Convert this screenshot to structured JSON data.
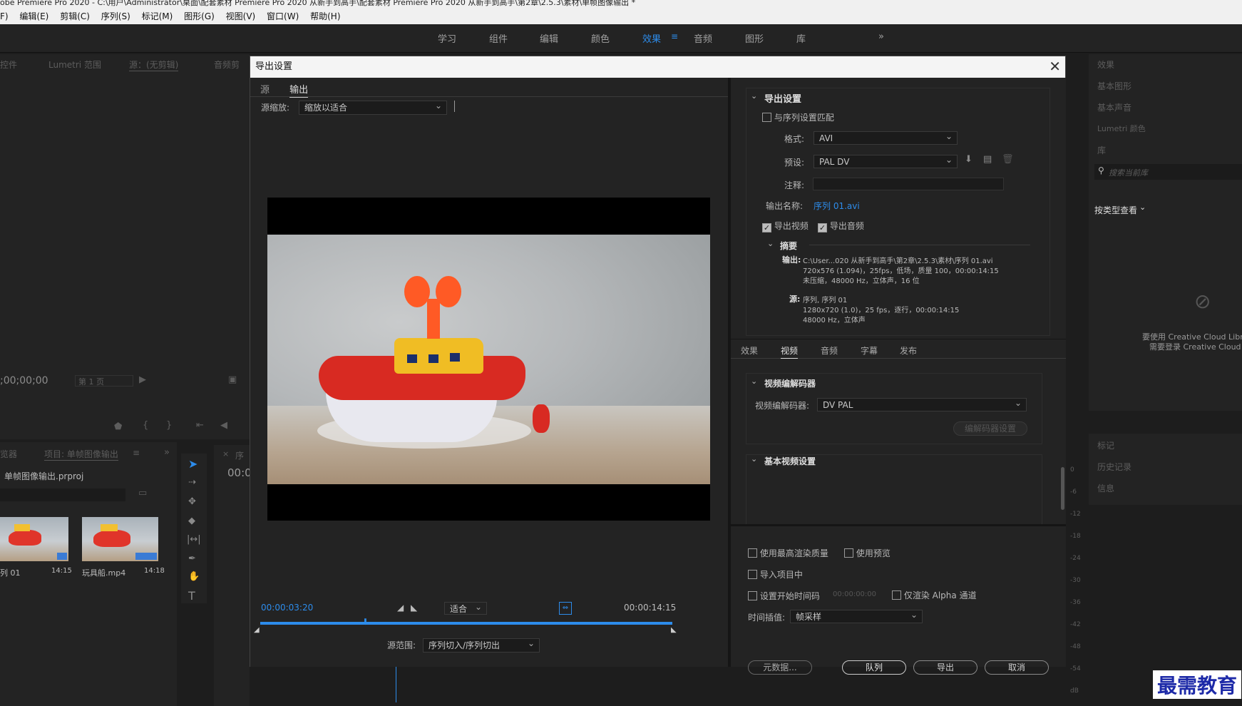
{
  "window": {
    "title": "obe Premiere Pro 2020 - C:\\用户\\Administrator\\桌面\\配套素材 Premiere Pro 2020 从新手到高手\\配套素材 Premiere Pro 2020 从新手到高手\\第2章\\2.5.3\\素材\\单帧图像输出 *"
  },
  "menu": [
    "F)",
    "编辑(E)",
    "剪辑(C)",
    "序列(S)",
    "标记(M)",
    "图形(G)",
    "视图(V)",
    "窗口(W)",
    "帮助(H)"
  ],
  "workspaces": {
    "items": [
      "学习",
      "组件",
      "编辑",
      "颜色",
      "效果",
      "音频",
      "图形",
      "库"
    ],
    "active": "效果",
    "more": "»"
  },
  "left_panel": {
    "tabs": [
      "控件",
      "Lumetri 范围",
      "源：(无剪辑)",
      "音频剪"
    ],
    "timecode": ";00;00;00",
    "page_select": "第 1 页",
    "project_tabs": [
      "览器",
      "项目: 单帧图像输出"
    ],
    "project_file": "单帧图像输出.prproj",
    "clips": [
      {
        "name": "列 01",
        "duration": "14:15"
      },
      {
        "name": "玩具船.mp4",
        "duration": "14:18"
      }
    ],
    "timeline_tab": "序",
    "timeline_timecode": "00:0"
  },
  "right_panel": {
    "items": [
      "效果",
      "基本图形",
      "基本声音",
      "Lumetri 颜色",
      "库"
    ],
    "search_placeholder": "搜索当前库",
    "view_by": "按类型查看",
    "cc_message_1": "要使用 Creative Cloud Libr",
    "cc_message_2": "需要登录 Creative Cloud",
    "bottom_items": [
      "标记",
      "历史记录",
      "信息"
    ],
    "meter_ticks": [
      "0",
      "-6",
      "-12",
      "-18",
      "-24",
      "-30",
      "-36",
      "-42",
      "-48",
      "-54",
      "dB"
    ]
  },
  "dialog": {
    "title": "导出设置",
    "tabs": [
      "源",
      "输出"
    ],
    "active_tab": "输出",
    "source_scale_label": "源缩放:",
    "source_scale_value": "缩放以适合",
    "timecode_current": "00:00:03:20",
    "timecode_end": "00:00:14:15",
    "fit_value": "适合",
    "playhead_fraction": 0.255,
    "source_range_label": "源范围:",
    "source_range_value": "序列切入/序列切出",
    "export_settings": {
      "heading": "导出设置",
      "match_sequence": "与序列设置匹配",
      "format_label": "格式:",
      "format_value": "AVI",
      "preset_label": "预设:",
      "preset_value": "PAL DV",
      "comments_label": "注释:",
      "output_name_label": "输出名称:",
      "output_name_value": "序列 01.avi",
      "export_video": "导出视频",
      "export_audio": "导出音频",
      "summary_heading": "摘要",
      "output_label": "输出:",
      "output_line1": "C:\\User...020 从新手到高手\\第2章\\2.5.3\\素材\\序列 01.avi",
      "output_line2": "720x576 (1.094)，25fps，低场，质量 100，00:00:14:15",
      "output_line3": "未压缩，48000 Hz，立体声，16 位",
      "source_label": "源:",
      "source_line1": "序列, 序列 01",
      "source_line2": "1280x720 (1.0)，25 fps，逐行，00:00:14:15",
      "source_line3": "48000 Hz，立体声"
    },
    "settings_tabs": [
      "效果",
      "视频",
      "音频",
      "字幕",
      "发布"
    ],
    "active_settings_tab": "视频",
    "video_codec_heading": "视频编解码器",
    "video_codec_label": "视频编解码器:",
    "video_codec_value": "DV PAL",
    "codec_settings_button": "编解码器设置",
    "basic_video_heading": "基本视频设置",
    "options": {
      "max_render_quality": "使用最高渲染质量",
      "use_previews": "使用预览",
      "import_into_project": "导入项目中",
      "set_start_timecode": "设置开始时间码",
      "start_timecode_value": "00:00:00:00",
      "render_alpha_only": "仅渲染 Alpha 通道",
      "time_interpolation_label": "时间插值:",
      "time_interpolation_value": "帧采样"
    },
    "buttons": {
      "metadata": "元数据...",
      "queue": "队列",
      "export": "导出",
      "cancel": "取消"
    }
  },
  "watermark": "最需教育",
  "colors": {
    "accent": "#2d8ceb",
    "dialog_bg": "#232323",
    "title_bg": "#f4f4f4"
  }
}
